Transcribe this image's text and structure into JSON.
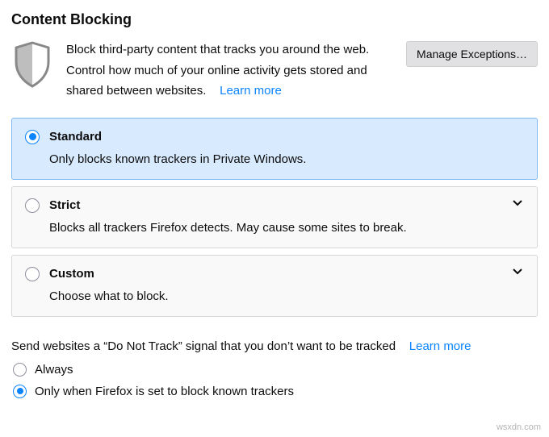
{
  "heading": "Content Blocking",
  "intro": {
    "text": "Block third-party content that tracks you around the web. Control how much of your online activity gets stored and shared between websites.",
    "learn_more": "Learn more"
  },
  "manage_exceptions_label": "Manage Exceptions…",
  "options": {
    "standard": {
      "title": "Standard",
      "desc": "Only blocks known trackers in Private Windows.",
      "selected": true,
      "expandable": false
    },
    "strict": {
      "title": "Strict",
      "desc": "Blocks all trackers Firefox detects. May cause some sites to break.",
      "selected": false,
      "expandable": true
    },
    "custom": {
      "title": "Custom",
      "desc": "Choose what to block.",
      "selected": false,
      "expandable": true
    }
  },
  "dnt": {
    "prompt": "Send websites a “Do Not Track” signal that you don’t want to be tracked",
    "learn_more": "Learn more",
    "always": {
      "label": "Always",
      "selected": false
    },
    "only_when": {
      "label": "Only when Firefox is set to block known trackers",
      "selected": true
    }
  },
  "watermark": "wsxdn.com"
}
